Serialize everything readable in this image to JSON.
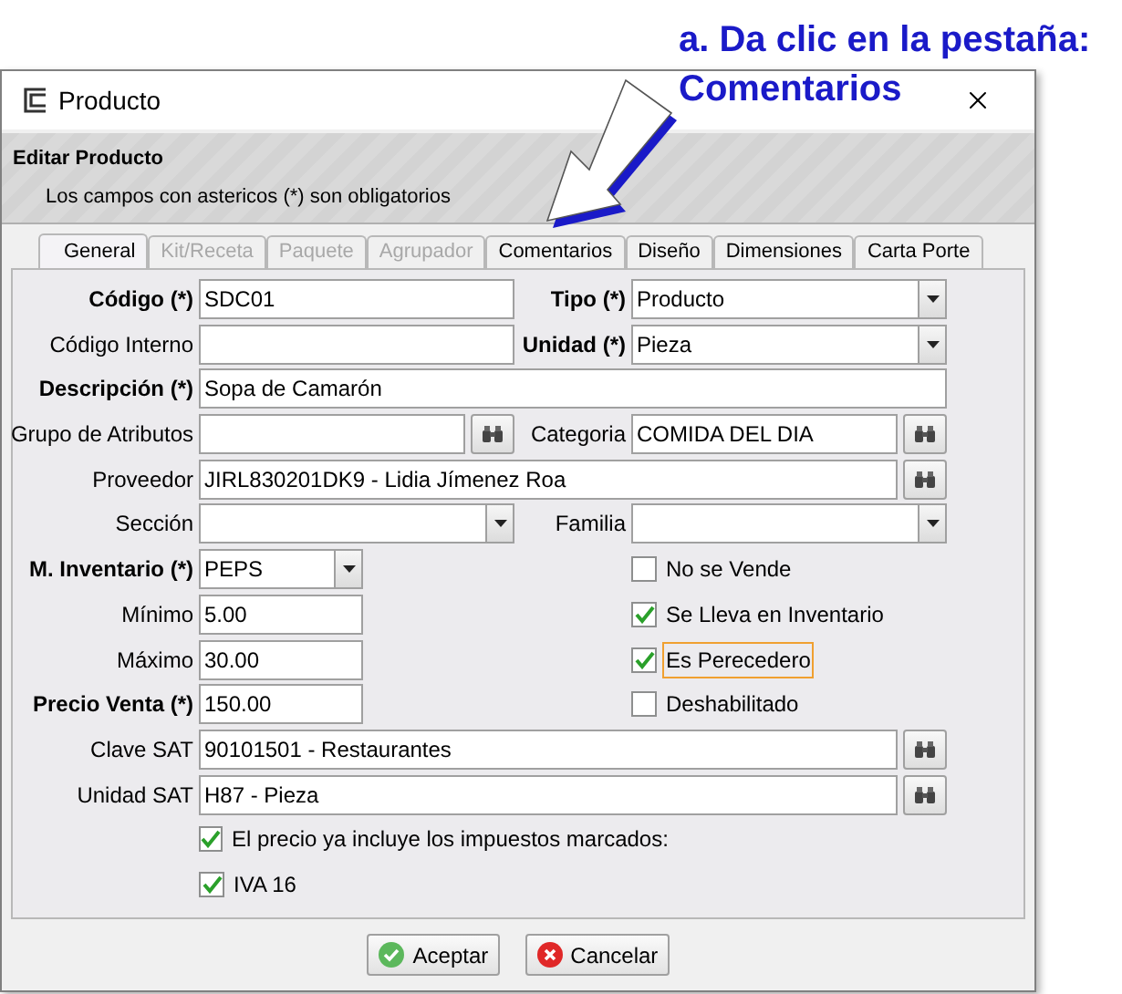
{
  "annotation": {
    "step": "a. Da clic en la pestaña:",
    "target": "Comentarios"
  },
  "window": {
    "title": "Producto"
  },
  "header": {
    "title": "Editar Producto",
    "subtitle": "Los campos con astericos (*) son obligatorios"
  },
  "tabs": [
    {
      "label": "General",
      "selected": true,
      "disabled": false
    },
    {
      "label": "Kit/Receta",
      "selected": false,
      "disabled": true
    },
    {
      "label": "Paquete",
      "selected": false,
      "disabled": true
    },
    {
      "label": "Agrupador",
      "selected": false,
      "disabled": true
    },
    {
      "label": "Comentarios",
      "selected": false,
      "disabled": false
    },
    {
      "label": "Diseño",
      "selected": false,
      "disabled": false
    },
    {
      "label": "Dimensiones",
      "selected": false,
      "disabled": false
    },
    {
      "label": "Carta Porte",
      "selected": false,
      "disabled": false
    }
  ],
  "rows": [
    {
      "left": {
        "kind": "text",
        "label": "Código (*)",
        "required": true,
        "value": "SDC01"
      },
      "right": {
        "kind": "select",
        "label": "Tipo (*)",
        "required": true,
        "value": "Producto"
      }
    },
    {
      "left": {
        "kind": "text",
        "label": "Código Interno",
        "required": false
      },
      "right": {
        "kind": "select",
        "label": "Unidad (*)",
        "required": true,
        "value": "Pieza"
      }
    },
    {
      "full": {
        "kind": "text",
        "label": "Descripción (*)",
        "required": true,
        "value": "Sopa de Camarón"
      }
    },
    {
      "left": {
        "kind": "lookup",
        "label": "Grupo de Atributos",
        "required": false
      },
      "right": {
        "kind": "lookup",
        "label": "Categoria",
        "required": false,
        "value": "COMIDA DEL DIA"
      }
    },
    {
      "full": {
        "kind": "lookup",
        "label": "Proveedor",
        "required": false,
        "value": "JIRL830201DK9 - Lidia Jímenez Roa"
      }
    },
    {
      "left": {
        "kind": "select",
        "label": "Sección",
        "required": false
      },
      "right": {
        "kind": "select",
        "label": "Familia",
        "required": false
      }
    },
    {
      "left": {
        "kind": "select",
        "label": "M. Inventario (*)",
        "required": true,
        "value": "PEPS",
        "short": true
      },
      "right": {
        "kind": "checkbox",
        "label": "No se Vende",
        "checked": false,
        "focused": false
      }
    },
    {
      "left": {
        "kind": "text",
        "label": "Mínimo",
        "required": false,
        "value": "5.00",
        "short": true
      },
      "right": {
        "kind": "checkbox",
        "label": "Se Lleva en Inventario",
        "checked": true,
        "focused": false
      }
    },
    {
      "left": {
        "kind": "text",
        "label": "Máximo",
        "required": false,
        "value": "30.00",
        "short": true
      },
      "right": {
        "kind": "checkbox",
        "label": "Es Perecedero",
        "checked": true,
        "focused": true
      }
    },
    {
      "left": {
        "kind": "text",
        "label": "Precio Venta (*)",
        "required": true,
        "value": "150.00",
        "short": true
      },
      "right": {
        "kind": "checkbox",
        "label": "Deshabilitado",
        "checked": false,
        "focused": false
      }
    },
    {
      "full": {
        "kind": "lookup",
        "label": "Clave SAT",
        "required": false,
        "value": "90101501 - Restaurantes"
      }
    },
    {
      "full": {
        "kind": "lookup",
        "label": "Unidad SAT",
        "required": false,
        "value": "H87 - Pieza"
      }
    },
    {
      "left": {
        "kind": "checkbox",
        "label": "El precio ya incluye los impuestos marcados:",
        "checked": true,
        "focused": false
      }
    },
    {
      "left": {
        "kind": "checkbox",
        "label": "IVA 16",
        "checked": true,
        "focused": false
      }
    }
  ],
  "buttons": [
    {
      "kind": "accept",
      "label": "Aceptar"
    },
    {
      "kind": "cancel",
      "label": "Cancelar"
    }
  ]
}
